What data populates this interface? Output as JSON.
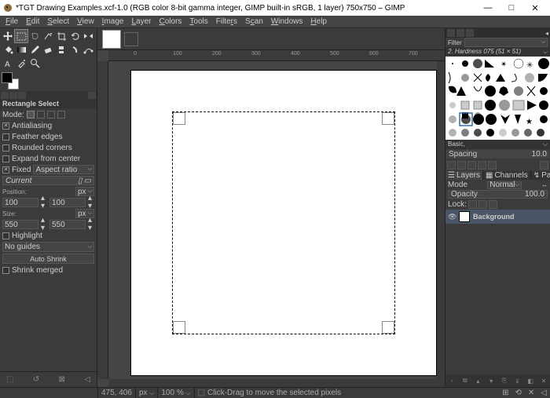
{
  "window": {
    "title": "*TGT Drawing Examples.xcf-1.0 (RGB color 8-bit gamma integer, GIMP built-in sRGB, 1 layer) 750x750 – GIMP",
    "minimize": "—",
    "maximize": "□",
    "close": "✕"
  },
  "menu": [
    "File",
    "Edit",
    "Select",
    "View",
    "Image",
    "Layer",
    "Colors",
    "Tools",
    "Filters",
    "Scan",
    "Windows",
    "Help"
  ],
  "tool_options": {
    "title": "Rectangle Select",
    "mode": "Mode:",
    "antialiasing": "Antialiasing",
    "feather": "Feather edges",
    "rounded": "Rounded corners",
    "expand": "Expand from center",
    "fixed": "Fixed",
    "fixed_dd": "Aspect ratio",
    "current": "Current",
    "position": "Position:",
    "pos_x": "100",
    "pos_y": "100",
    "pos_unit": "px",
    "size": "Size:",
    "size_w": "550",
    "size_h": "550",
    "size_unit": "px",
    "highlight": "Highlight",
    "guides": "No guides",
    "auto_shrink": "Auto Shrink",
    "shrink_merged": "Shrink merged"
  },
  "brushes": {
    "filter_lbl": "Filter",
    "header": "2. Hardness 075 (51 × 51)",
    "basic": "Basic,",
    "spacing_lbl": "Spacing",
    "spacing_val": "10.0"
  },
  "layers": {
    "tabs": [
      "Layers",
      "Channels",
      "Paths"
    ],
    "mode_lbl": "Mode",
    "mode_val": "Normal",
    "opacity_lbl": "Opacity",
    "opacity_val": "100.0",
    "lock_lbl": "Lock:",
    "layer_name": "Background"
  },
  "status": {
    "coords": "475, 406",
    "unit": "px",
    "zoom": "100 %",
    "hint": "Click-Drag to move the selected pixels"
  },
  "ruler_ticks": [
    "0",
    "100",
    "200",
    "300",
    "400",
    "500",
    "600",
    "700"
  ]
}
